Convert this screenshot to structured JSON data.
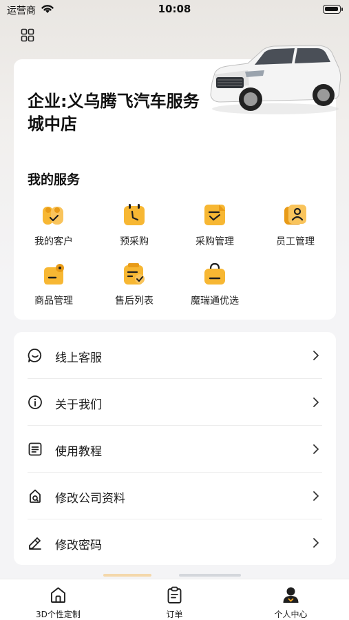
{
  "status_bar": {
    "carrier": "运营商",
    "time": "10:08"
  },
  "company": {
    "name": "企业:义乌腾飞汽车服务城中店"
  },
  "services": {
    "title": "我的服务",
    "items": [
      {
        "label": "我的客户",
        "icon": "customers-icon"
      },
      {
        "label": "预采购",
        "icon": "pre-purchase-icon"
      },
      {
        "label": "采购管理",
        "icon": "purchase-management-icon"
      },
      {
        "label": "员工管理",
        "icon": "staff-management-icon"
      },
      {
        "label": "商品管理",
        "icon": "product-management-icon"
      },
      {
        "label": "售后列表",
        "icon": "after-sales-icon"
      },
      {
        "label": "魔瑞通优选",
        "icon": "shopping-bag-icon"
      }
    ]
  },
  "menu": {
    "items": [
      {
        "label": "线上客服",
        "icon": "chat-bubble-icon"
      },
      {
        "label": "关于我们",
        "icon": "info-icon"
      },
      {
        "label": "使用教程",
        "icon": "document-icon"
      },
      {
        "label": "修改公司资料",
        "icon": "edit-company-icon"
      },
      {
        "label": "修改密码",
        "icon": "edit-pencil-icon"
      }
    ]
  },
  "tab_bar": {
    "items": [
      {
        "label": "3D个性定制",
        "icon": "home-icon"
      },
      {
        "label": "订单",
        "icon": "clipboard-icon"
      },
      {
        "label": "个人中心",
        "icon": "profile-icon",
        "active": true
      }
    ]
  },
  "colors": {
    "accent_orange": "#f5a623",
    "icon_dark": "#1f1f1f"
  }
}
